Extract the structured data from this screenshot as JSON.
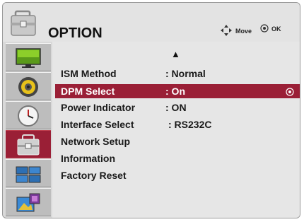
{
  "header": {
    "title": "OPTION",
    "icon": "toolbox-icon",
    "hint_move": "Move",
    "hint_ok": "OK"
  },
  "sidebar": {
    "items": [
      {
        "name": "picture",
        "icon": "monitor-icon"
      },
      {
        "name": "audio",
        "icon": "speaker-icon"
      },
      {
        "name": "time",
        "icon": "clock-icon"
      },
      {
        "name": "option",
        "icon": "toolbox-icon",
        "active": true
      },
      {
        "name": "tile",
        "icon": "tile-display-icon"
      },
      {
        "name": "pip",
        "icon": "picture-icon"
      }
    ]
  },
  "menu": {
    "scroll_up": "▲",
    "rows": [
      {
        "label": "ISM Method",
        "value": ": Normal"
      },
      {
        "label": "DPM Select",
        "value": ": On",
        "selected": true
      },
      {
        "label": "Power Indicator",
        "value": ": ON"
      },
      {
        "label": "Interface Select",
        "value": ": RS232C"
      },
      {
        "label": "Network Setup",
        "value": ""
      },
      {
        "label": "Information",
        "value": ""
      },
      {
        "label": "Factory Reset",
        "value": ""
      }
    ]
  },
  "colors": {
    "accent": "#9a1f36",
    "background": "#d9d9d9"
  }
}
